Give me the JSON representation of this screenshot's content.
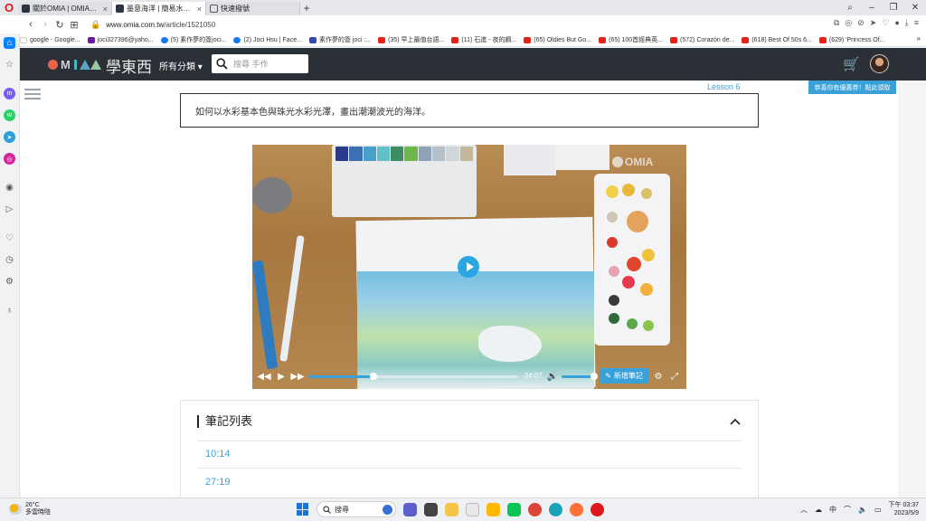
{
  "browser": {
    "tabs": [
      {
        "label": "關於OMIA | OMIA學東西"
      },
      {
        "label": "墨意海洋 | 簡易水彩X鏡粉",
        "active": true
      },
      {
        "label": "快速撥號"
      }
    ],
    "new_tab": "+",
    "url_host": "www.omia.com.tw",
    "url_path": "/article/1521050",
    "bookmarks": [
      {
        "label": "google - Google...",
        "color": "#ffffff",
        "icon": "google-icon"
      },
      {
        "label": "joci327396@yaho...",
        "color": "#6a1b9a",
        "icon": "mail-icon"
      },
      {
        "label": "(5) 素作夢的簽joci...",
        "color": "#1877f2",
        "icon": "facebook-icon"
      },
      {
        "label": "(2) Joci Hsu | Face...",
        "color": "#1877f2",
        "icon": "facebook-icon"
      },
      {
        "label": "素作夢的簽 joci :...",
        "color": "#3949ab",
        "icon": "blog-icon"
      },
      {
        "label": "(35) 早上最值台語...",
        "color": "#e62117",
        "icon": "youtube-icon"
      },
      {
        "label": "(11) 石進 - 夜的鋼...",
        "color": "#e62117",
        "icon": "youtube-icon"
      },
      {
        "label": "(65) Oldies But Go...",
        "color": "#e62117",
        "icon": "youtube-icon"
      },
      {
        "label": "(65) 100首經典英...",
        "color": "#e62117",
        "icon": "youtube-icon"
      },
      {
        "label": "(572) Corazón de...",
        "color": "#e62117",
        "icon": "youtube-icon"
      },
      {
        "label": "(618) Best Of 50s 6...",
        "color": "#e62117",
        "icon": "youtube-icon"
      },
      {
        "label": "(629) 'Princess Of...",
        "color": "#e62117",
        "icon": "youtube-icon"
      }
    ]
  },
  "site": {
    "logo_text": "OMIA",
    "brand_cn": "學東西",
    "category_menu": "所有分類",
    "search_placeholder": "搜尋 手作",
    "coupon_text": "恭喜你有優惠券！點此領取"
  },
  "lesson": {
    "label": "Lesson 6",
    "description": "如何以水彩基本色與珠光水彩光澤，畫出潮潮波光的海洋。"
  },
  "video": {
    "progress_fraction": 0.31,
    "remaining_time": "-34:07",
    "volume_fraction": 1.0,
    "add_note_label": "新增筆記",
    "watermark": "OMIA"
  },
  "notes": {
    "title": "筆記列表",
    "items": [
      {
        "time": "10:14"
      },
      {
        "time": "27:19"
      }
    ]
  },
  "taskbar": {
    "temperature": "26°C",
    "weather": "多雲時陰",
    "search_label": "搜尋",
    "ime": "中",
    "time": "下午 03:37",
    "date": "2023/5/9"
  },
  "colors": {
    "accent": "#3aa0d8",
    "header_bg": "#2b2f36",
    "opera_red": "#e0161d"
  }
}
